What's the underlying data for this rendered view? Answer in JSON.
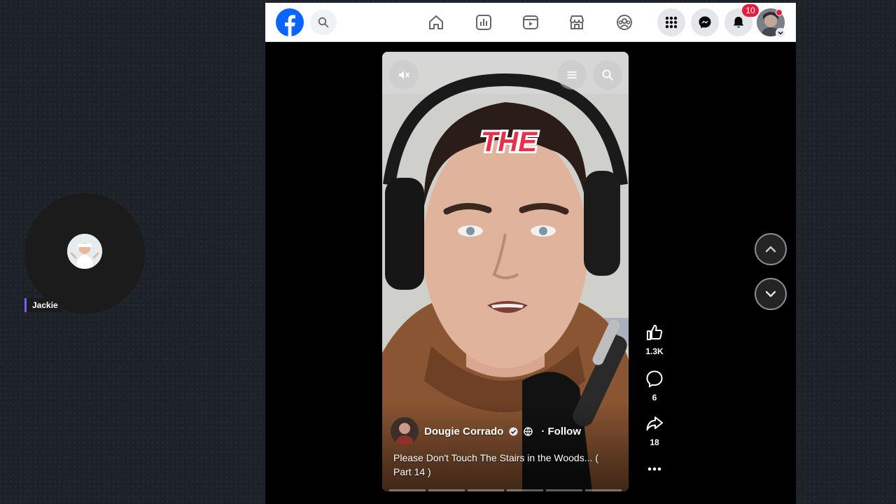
{
  "participant": {
    "name": "Jackie"
  },
  "notifications": {
    "count": "10"
  },
  "reel": {
    "overlay_caption": "THE",
    "author": "Dougie Corrado",
    "follow_label": "· Follow",
    "description": "Please Don't Touch The Stairs in the Woods... ( Part 14 )",
    "progress_segments": 6
  },
  "actions": {
    "likes": "1.3K",
    "comments": "6",
    "shares": "18"
  },
  "colors": {
    "facebook_blue": "#0866ff",
    "badge_red": "#e41e3f",
    "participant_accent": "#7b5cf5"
  },
  "icons": {
    "nav": [
      "home-icon",
      "dashboard-icon",
      "video-icon",
      "marketplace-icon",
      "groups-icon"
    ],
    "right": [
      "menu-grid-icon",
      "messenger-icon",
      "bell-icon"
    ]
  }
}
